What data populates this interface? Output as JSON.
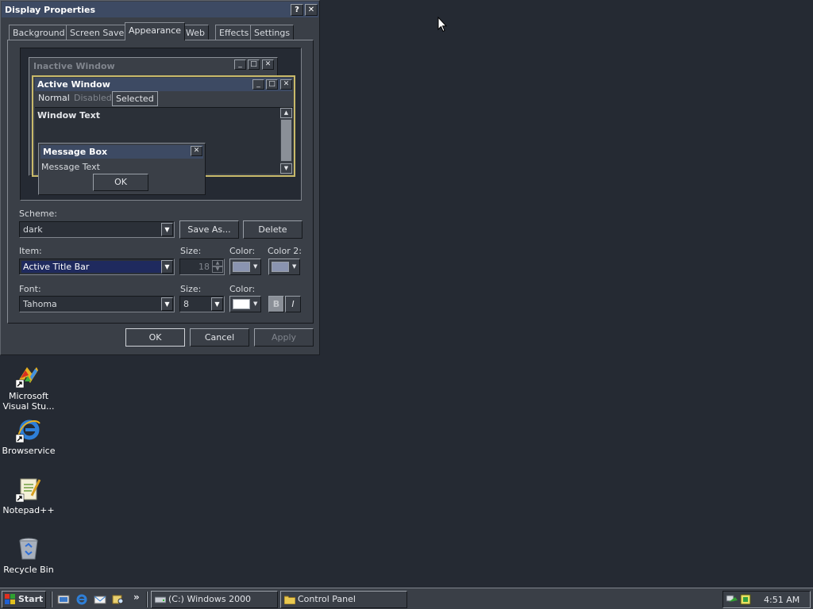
{
  "dialog": {
    "title": "Display Properties",
    "help_button": "?",
    "close_button": "✕",
    "tabs": [
      "Background",
      "Screen Saver",
      "Appearance",
      "Web",
      "Effects",
      "Settings"
    ],
    "active_tab": "Appearance",
    "preview": {
      "inactive_window_title": "Inactive Window",
      "active_window_title": "Active Window",
      "menu_items": [
        "Normal",
        "Disabled",
        "Selected"
      ],
      "window_text": "Window Text",
      "message_box_title": "Message Box",
      "message_text": "Message Text",
      "ok_label": "OK"
    },
    "scheme": {
      "label": "Scheme:",
      "value": "dark"
    },
    "save_as_label": "Save As...",
    "delete_label": "Delete",
    "item": {
      "label": "Item:",
      "value": "Active Title Bar"
    },
    "item_size": {
      "label": "Size:",
      "value": "18"
    },
    "item_color": {
      "label": "Color:",
      "value": "#8a94b0"
    },
    "item_color2": {
      "label": "Color 2:",
      "value": "#8a94b0"
    },
    "font": {
      "label": "Font:",
      "value": "Tahoma"
    },
    "font_size": {
      "label": "Size:",
      "value": "8"
    },
    "font_color": {
      "label": "Color:",
      "value": "#ffffff"
    },
    "bold_label": "B",
    "italic_label": "I",
    "ok_label": "OK",
    "cancel_label": "Cancel",
    "apply_label": "Apply"
  },
  "desktop_icons": [
    {
      "label": "Microsoft Visual Stu...",
      "icon": "visual-studio-icon"
    },
    {
      "label": "Browservice",
      "icon": "internet-explorer-icon"
    },
    {
      "label": "Notepad++",
      "icon": "notepad-plus-plus-icon"
    },
    {
      "label": "Recycle Bin",
      "icon": "recycle-bin-icon"
    }
  ],
  "taskbar": {
    "start_label": "Start",
    "overflow_label": "»",
    "tasks": [
      {
        "label": "(C:) Windows 2000",
        "icon": "drive-icon"
      },
      {
        "label": "Control Panel",
        "icon": "folder-icon"
      }
    ],
    "clock": "4:51 AM"
  },
  "colors": {
    "desktop": "#252a33",
    "window_face": "#3a3f47",
    "active_title": "#3d4a63",
    "inactive_title": "#3a3f47",
    "selection": "#1f2a5e",
    "accent_border": "#c8b96a"
  }
}
